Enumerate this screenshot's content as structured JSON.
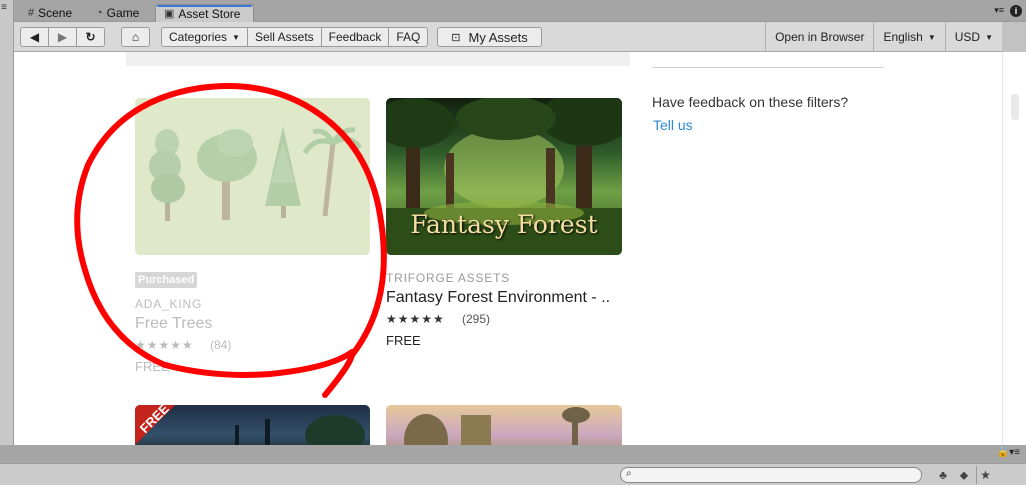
{
  "editor_tabs": [
    {
      "label": "Scene",
      "icon": "grid-icon"
    },
    {
      "label": "Game",
      "icon": "pacman-icon"
    },
    {
      "label": "Asset Store",
      "icon": "store-bag-icon"
    }
  ],
  "toolbar": {
    "nav": {
      "back": "back-icon",
      "forward": "forward-icon",
      "refresh": "refresh-icon",
      "home": "home-icon"
    },
    "menu": [
      "Categories",
      "Sell Assets",
      "Feedback",
      "FAQ"
    ],
    "my_assets": "My Assets",
    "open_in_browser": "Open in Browser",
    "language": "English",
    "currency": "USD"
  },
  "sidebar": {
    "question": "Have feedback on these filters?",
    "link": "Tell us"
  },
  "assets": [
    {
      "badge": "Purchased",
      "publisher": "ADA_KING",
      "name": "Free Trees",
      "stars": "★★★★★",
      "rating_count": "(84)",
      "price": "FREE"
    },
    {
      "publisher": "TRIFORGE ASSETS",
      "name": "Fantasy Forest Environment - ..",
      "image_title": "Fantasy Forest",
      "stars": "★★★★★",
      "rating_count": "(295)",
      "price": "FREE"
    }
  ],
  "partial_cards": [
    {
      "ribbon": "FREE"
    }
  ],
  "annotation": {
    "color": "#ff0000",
    "shape": "hand-drawn circle around first asset card"
  },
  "colors": {
    "accent_link": "#2b8ad6",
    "tab_highlight": "#3a79d8"
  }
}
